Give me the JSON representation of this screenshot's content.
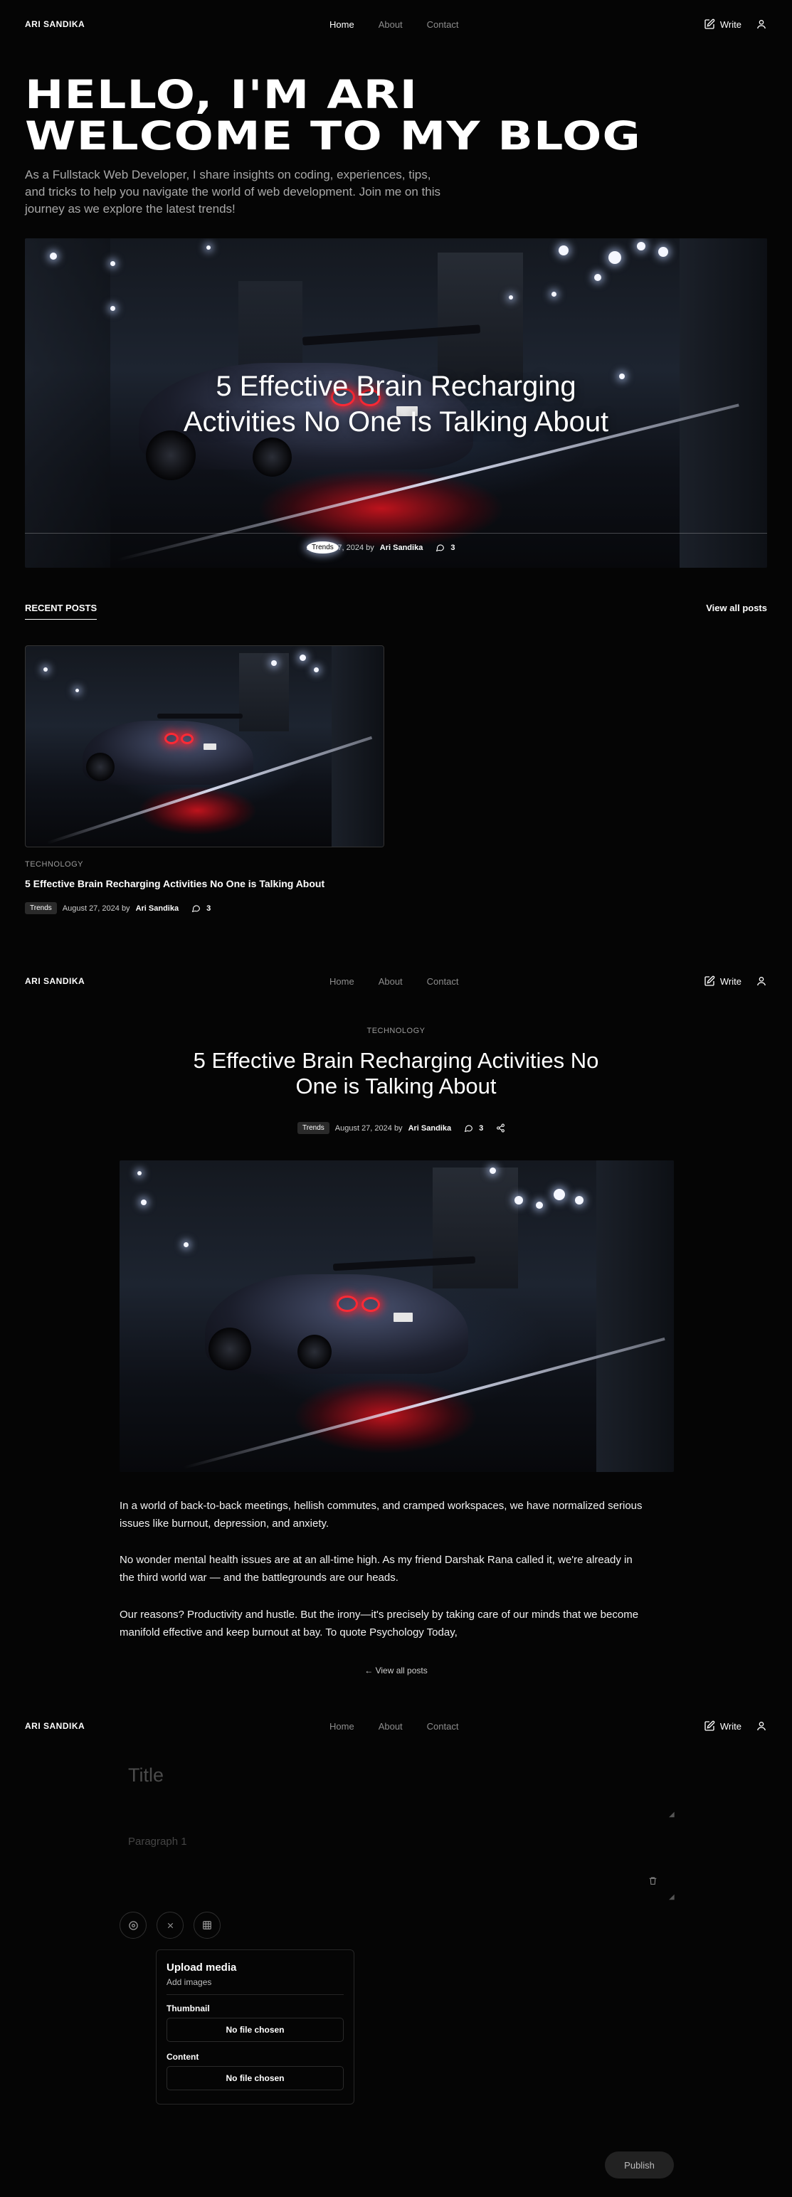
{
  "brand": "ARI SANDIKA",
  "nav": {
    "home": "Home",
    "about": "About",
    "contact": "Contact",
    "write": "Write"
  },
  "hero": {
    "title_line1": "HELLO, I'M ARI",
    "title_line2": "WELCOME TO MY BLOG",
    "subtitle": "As a Fullstack Web Developer, I share insights on coding, experiences, tips, and tricks to help you navigate the world of web development. Join me on this journey as we explore the latest trends!"
  },
  "featured": {
    "title_line1": "5 Effective Brain Recharging",
    "title_line2": "Activities No One Is Talking About",
    "tag": "Trends",
    "date": "August 27, 2024 by",
    "author": "Ari Sandika",
    "comments": "3"
  },
  "recent": {
    "heading": "RECENT POSTS",
    "view_all": "View all posts",
    "card": {
      "category": "TECHNOLOGY",
      "title": "5 Effective Brain Recharging Activities No One is Talking About",
      "tag": "Trends",
      "date": "August 27, 2024 by",
      "author": "Ari Sandika",
      "comments": "3"
    }
  },
  "post": {
    "category": "TECHNOLOGY",
    "title_line1": "5 Effective Brain Recharging Activities No",
    "title_line2": "One is Talking About",
    "tag": "Trends",
    "date": "August 27, 2024 by",
    "author": "Ari Sandika",
    "comments": "3",
    "paragraphs": [
      "In a world of back-to-back meetings, hellish commutes, and cramped workspaces, we have normalized serious issues like burnout, depression, and anxiety.",
      "No wonder mental health issues are at an all-time high. As my friend Darshak Rana called it, we're already in the third world war — and the battlegrounds are our heads.",
      "Our reasons? Productivity and hustle. But the irony—it's precisely by taking care of our minds that we become manifold effective and keep burnout at bay. To quote Psychology Today,"
    ],
    "back_link": "← View all posts"
  },
  "editor": {
    "title_placeholder": "Title",
    "paragraph_placeholder": "Paragraph 1",
    "upload": {
      "heading": "Upload media",
      "sub": "Add images",
      "thumbnail_label": "Thumbnail",
      "thumbnail_value": "No file chosen",
      "content_label": "Content",
      "content_value": "No file chosen"
    },
    "publish": "Publish"
  }
}
